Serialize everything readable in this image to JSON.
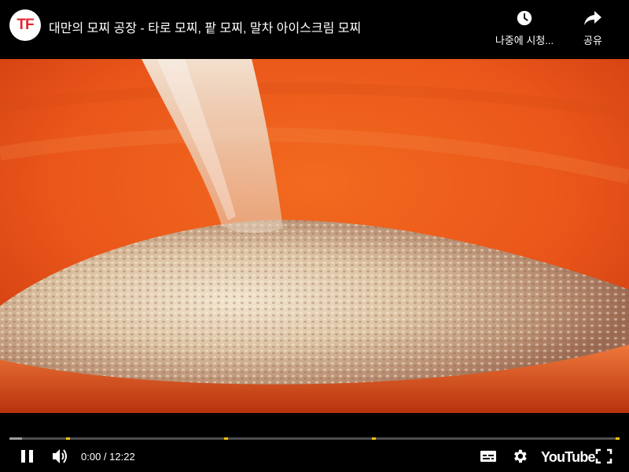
{
  "header": {
    "channel_logo_text": "TF",
    "title": "대만의 모찌 공장 - 타로 모찌, 팥 모찌, 말차 아이스크림 모찌",
    "actions": [
      {
        "label": "나중에 시청...",
        "icon": "clock-icon"
      },
      {
        "label": "공유",
        "icon": "share-arrow-icon"
      }
    ]
  },
  "player": {
    "current_time": "0:00",
    "duration": "12:22",
    "time_display": "0:00 / 12:22",
    "buffered_fraction": 0.02,
    "chapter_markers": [
      0.095,
      0.355,
      0.597,
      0.998
    ],
    "brand": "YouTube",
    "controls": [
      "pause-icon",
      "volume-icon",
      "subtitles-icon",
      "settings-gear-icon",
      "fullscreen-icon"
    ]
  },
  "colors": {
    "bowl_orange": "#e85a1e",
    "chapter_marker": "#f5c400",
    "channel_logo_red": "#e4262e"
  }
}
